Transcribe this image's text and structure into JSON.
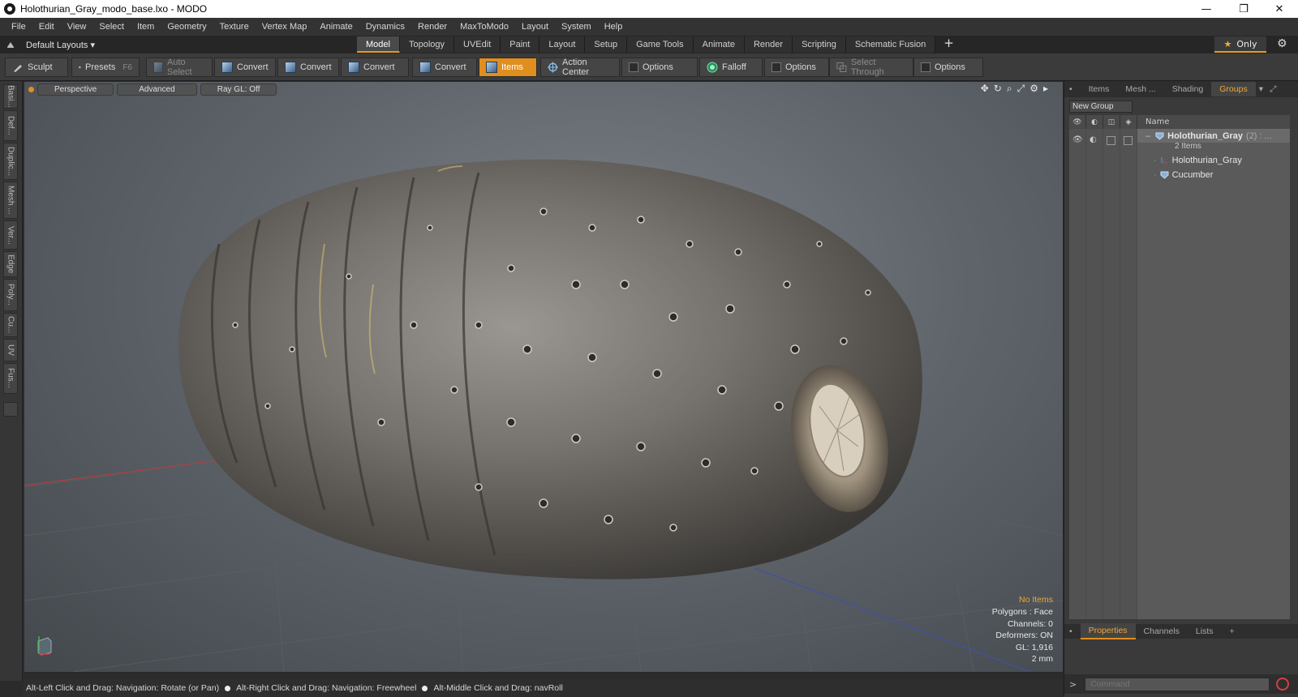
{
  "window": {
    "title": "Holothurian_Gray_modo_base.lxo - MODO",
    "minimize": "—",
    "restore": "❐",
    "close": "✕"
  },
  "menu": [
    "File",
    "Edit",
    "View",
    "Select",
    "Item",
    "Geometry",
    "Texture",
    "Vertex Map",
    "Animate",
    "Dynamics",
    "Render",
    "MaxToModo",
    "Layout",
    "System",
    "Help"
  ],
  "layouts": {
    "label": "Default Layouts ▾"
  },
  "layout_tabs": [
    {
      "label": "Model",
      "active": true
    },
    {
      "label": "Topology"
    },
    {
      "label": "UVEdit"
    },
    {
      "label": "Paint"
    },
    {
      "label": "Layout"
    },
    {
      "label": "Setup"
    },
    {
      "label": "Game Tools"
    },
    {
      "label": "Animate"
    },
    {
      "label": "Render"
    },
    {
      "label": "Scripting"
    },
    {
      "label": "Schematic Fusion"
    }
  ],
  "only_label": "Only",
  "toolbar": {
    "sculpt": "Sculpt",
    "presets": "Presets",
    "presets_key": "F6",
    "auto_select": "Auto Select",
    "convert1": "Convert",
    "convert2": "Convert",
    "convert3": "Convert",
    "convert4": "Convert",
    "items": "Items",
    "action_center": "Action Center",
    "options1": "Options",
    "falloff": "Falloff",
    "options2": "Options",
    "select_through": "Select Through",
    "options3": "Options"
  },
  "left_tabs": [
    "Basi...",
    "Def...",
    "Duplic...",
    "Mesh ...",
    "Ver...",
    "Edge",
    "Poly...",
    "Cu...",
    "UV",
    "Fus..."
  ],
  "viewport": {
    "perspective": "Perspective",
    "advanced": "Advanced",
    "raygl": "Ray GL: Off",
    "info": {
      "selection": "No Items",
      "polygons": "Polygons : Face",
      "channels": "Channels: 0",
      "deformers": "Deformers: ON",
      "gl": "GL: 1,916",
      "units": "2 mm"
    }
  },
  "status": {
    "hint1": "Alt-Left Click and Drag: Navigation: Rotate (or Pan)",
    "hint2": "Alt-Right Click and Drag: Navigation: Freewheel",
    "hint3": "Alt-Middle Click and Drag: navRoll"
  },
  "right_panel": {
    "tabs": [
      "Items",
      "Mesh ...",
      "Shading",
      "Groups"
    ],
    "new_group": "New Group",
    "name_header": "Name",
    "group_name": "Holothurian_Gray",
    "group_count": "(2) : ...",
    "group_sub": "2 Items",
    "children": [
      "Holothurian_Gray",
      "Cucumber"
    ],
    "bottom_tabs": [
      "Properties",
      "Channels",
      "Lists"
    ],
    "command_placeholder": "Command"
  },
  "colors": {
    "accent": "#e08e1e",
    "highlight_text": "#f0a830"
  }
}
